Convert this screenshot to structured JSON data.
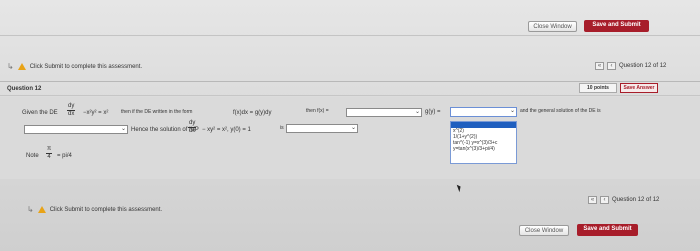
{
  "toolbar": {
    "close_window": "Close Window",
    "save_and_submit": "Save and Submit"
  },
  "submit_notice": "Click Submit to complete this assessment.",
  "question_nav": {
    "label": "Question 12 of 12",
    "prev_glyph": "«",
    "back_glyph": "‹"
  },
  "question": {
    "title": "Question 12",
    "points": "10 points",
    "save_answer": "Save Answer"
  },
  "problem": {
    "given_prefix": "Given the DE",
    "dy": "dy",
    "dx": "dx",
    "expr1": "−x²y² = x²",
    "then_text": "then if the DE written in the form",
    "form_text": "f(x)dx = g(y)dy",
    "then_fx": "then f(x) =",
    "gy": "g(y) =",
    "general_text": "and the general solution of the DE is",
    "hence_text": "Hence the solution of IVP",
    "expr2": "− xy² = x², y(0) = 1",
    "is_text": "is",
    "note_label": "Note",
    "pi": "π",
    "four": "4",
    "note_value": "= pi/4"
  },
  "dropdown_options": [
    "x^(2)",
    "1/(1+y^(2))",
    "tan^(-1) y=x^(3)/3+c",
    "y=tan(x^(3)/3+pi/4)"
  ],
  "bottom": {
    "submit_notice": "Click Submit to complete this assessment.",
    "nav_label": "Question 12 of 12",
    "close_window": "Close Window",
    "save_and_submit": "Save and Submit"
  }
}
